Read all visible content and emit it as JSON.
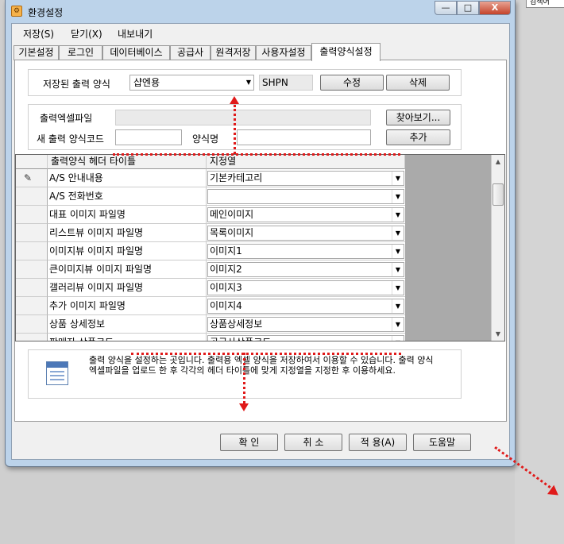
{
  "background": {
    "tab_text": "검색어"
  },
  "window": {
    "title": "환경설정",
    "min_glyph": "—",
    "max_glyph": "□",
    "close_glyph": "X"
  },
  "menu": [
    {
      "label": "저장(S)"
    },
    {
      "label": "닫기(X)"
    },
    {
      "label": "내보내기"
    }
  ],
  "tabs": [
    {
      "label": "기본설정"
    },
    {
      "label": "로그인"
    },
    {
      "label": "데이터베이스"
    },
    {
      "label": "공급사"
    },
    {
      "label": "원격저장"
    },
    {
      "label": "사용자설정"
    },
    {
      "label": "출력양식설정"
    }
  ],
  "active_tab": "출력양식설정",
  "saved_format": {
    "label": "저장된 출력 양식",
    "value": "샵엔용",
    "code": "SHPN",
    "edit_button": "수정",
    "delete_button": "삭제"
  },
  "excel": {
    "file_label": "출력엑셀파일",
    "file_value": "",
    "browse_button": "찾아보기...",
    "new_code_label": "새 출력 양식코드",
    "new_code_value": "",
    "name_label": "양식명",
    "name_value": "",
    "add_button": "추가"
  },
  "grid": {
    "columns": [
      "출력양식 헤더 타이틀",
      "지정열"
    ],
    "rows": [
      {
        "title": "A/S 안내내용",
        "mapping": "기본카테고리",
        "editing": true
      },
      {
        "title": "A/S 전화번호",
        "mapping": ""
      },
      {
        "title": "대표 이미지 파일명",
        "mapping": "메인이미지"
      },
      {
        "title": "리스트뷰 이미지 파일명",
        "mapping": "목록이미지"
      },
      {
        "title": "이미지뷰 이미지 파일명",
        "mapping": "이미지1"
      },
      {
        "title": "큰이미지뷰 이미지 파일명",
        "mapping": "이미지2"
      },
      {
        "title": "갤러리뷰 이미지 파일명",
        "mapping": "이미지3"
      },
      {
        "title": "추가 이미지 파일명",
        "mapping": "이미지4"
      },
      {
        "title": "상품 상세정보",
        "mapping": "상품상세정보"
      },
      {
        "title": "판매자 상품코드",
        "mapping": "공급사상품코드"
      }
    ]
  },
  "info": {
    "text": "출력 양식을 설정하는 곳입니다. 출력용 엑셀 양식을 저장하여서 이용할 수 있습니다. 출력 양식 엑셀파일을 업로드 한 후 각각의 헤더 타이틀에 맞게 지정열을 지정한 후 이용하세요."
  },
  "footer": {
    "ok": "확 인",
    "cancel": "취 소",
    "apply": "적 용(A)",
    "help": "도움말"
  },
  "annotation_color": "#e01a1a"
}
